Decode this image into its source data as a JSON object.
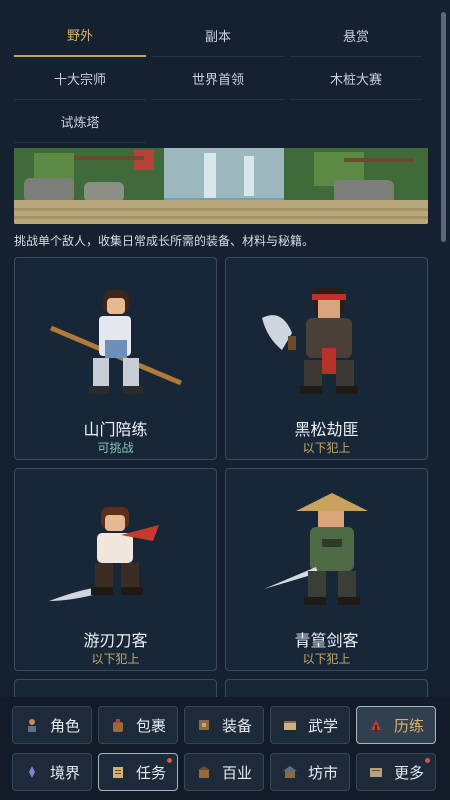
{
  "tabs": [
    "野外",
    "副本",
    "悬赏",
    "十大宗师",
    "世界首领",
    "木桩大赛",
    "试炼塔"
  ],
  "active_tab": "野外",
  "description": "挑战单个敌人，收集日常成长所需的装备、材料与秘籍。",
  "enemies": [
    {
      "name": "山门陪练",
      "status": "可挑战"
    },
    {
      "name": "黑松劫匪",
      "status": "以下犯上"
    },
    {
      "name": "游刃刀客",
      "status": "以下犯上"
    },
    {
      "name": "青篁剑客",
      "status": "以下犯上"
    }
  ],
  "nav": [
    {
      "label": "角色",
      "icon": "character-icon"
    },
    {
      "label": "包裹",
      "icon": "bag-icon"
    },
    {
      "label": "装备",
      "icon": "equipment-icon"
    },
    {
      "label": "武学",
      "icon": "martial-arts-icon"
    },
    {
      "label": "历练",
      "icon": "training-icon"
    },
    {
      "label": "境界",
      "icon": "realm-icon"
    },
    {
      "label": "任务",
      "icon": "quest-icon"
    },
    {
      "label": "百业",
      "icon": "profession-icon"
    },
    {
      "label": "坊市",
      "icon": "market-icon"
    },
    {
      "label": "更多",
      "icon": "more-icon"
    }
  ],
  "colors": {
    "accent": "#d9b36a",
    "background": "#152130",
    "ok_status": "#86c8b7",
    "badge": "#e0534d"
  }
}
